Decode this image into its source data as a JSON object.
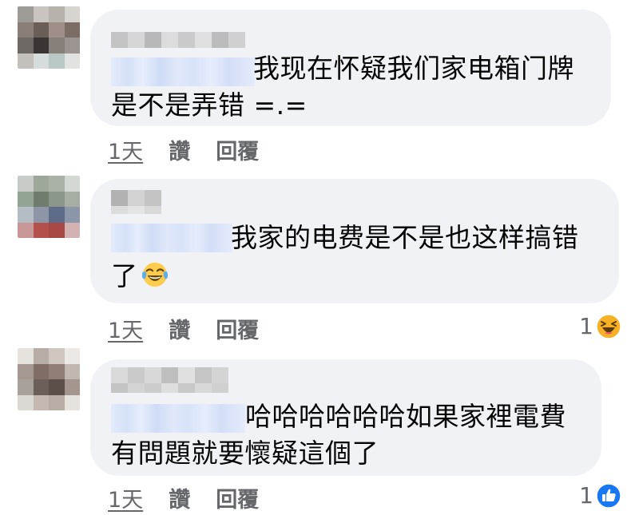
{
  "comments": [
    {
      "text_line1": "我现在怀疑我们家电箱门牌",
      "text_line2": "是不是弄错 =.=",
      "time": "1天",
      "like_label": "讚",
      "reply_label": "回覆",
      "reaction_count": "",
      "reaction_icon": ""
    },
    {
      "text_line1": "我家的电费是不是也这样搞错",
      "text_line2": "了",
      "inline_emoji": "laughing-tears-emoji",
      "time": "1天",
      "like_label": "讚",
      "reply_label": "回覆",
      "reaction_count": "1",
      "reaction_icon": "haha-reaction-icon"
    },
    {
      "text_line1": "哈哈哈哈哈哈如果家裡電費",
      "text_line2": "有問題就要懷疑這個了",
      "time": "1天",
      "like_label": "讚",
      "reply_label": "回覆",
      "reaction_count": "1",
      "reaction_icon": "like-reaction-icon"
    }
  ],
  "colors": {
    "bubble": "#f0f2f5",
    "secondary_text": "#65676b",
    "like_blue": "#1877f2",
    "haha_yellow": "#f7b125"
  }
}
